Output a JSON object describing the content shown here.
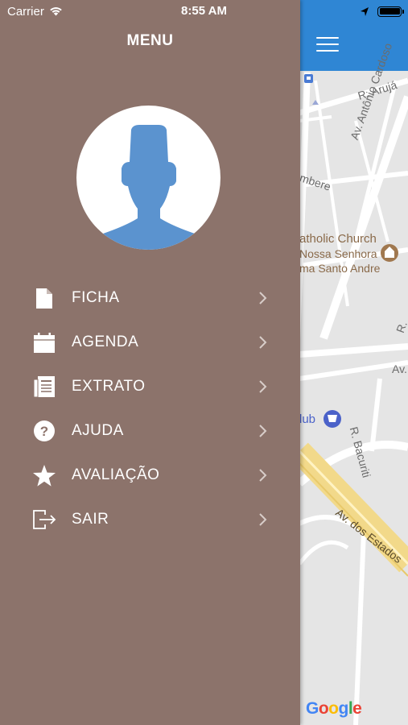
{
  "status_bar": {
    "carrier": "Carrier",
    "time": "8:55 AM",
    "icons": [
      "wifi-icon",
      "location-arrow-icon",
      "battery-icon"
    ]
  },
  "drawer": {
    "title": "MENU",
    "background_color": "#8c736b",
    "avatar": {
      "icon": "user-silhouette-icon",
      "color": "#5b93cf"
    },
    "items": [
      {
        "label": "FICHA",
        "icon": "document-icon"
      },
      {
        "label": "AGENDA",
        "icon": "calendar-icon"
      },
      {
        "label": "EXTRATO",
        "icon": "statement-icon"
      },
      {
        "label": "AJUDA",
        "icon": "help-icon"
      },
      {
        "label": "AVALIAÇÃO",
        "icon": "star-icon"
      },
      {
        "label": "SAIR",
        "icon": "logout-icon"
      }
    ]
  },
  "map": {
    "header_color": "#2f86d4",
    "labels": {
      "street_aruja": "R. Arujá",
      "street_antonio": "Av. Antônio Cardoso",
      "street_ubere": "mbere",
      "poi_church": "atholic Church",
      "poi_church_line2": "Nossa Senhora",
      "poi_church_line3": "ma Santo Andre",
      "street_r": "R.",
      "street_av": "Av.",
      "street_bacuriti": "R. Bacuriti",
      "poi_club": "lub",
      "street_estados": "Av. dos Estados",
      "google": "Google"
    }
  }
}
